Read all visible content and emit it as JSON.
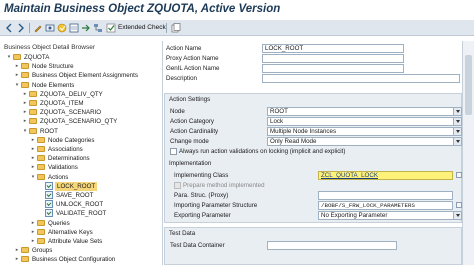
{
  "window": {
    "title": "Maintain Business Object ZQUOTA, Active Version"
  },
  "toolbar": {
    "extended_check_label": "Extended Check"
  },
  "tree": {
    "header": "Business Object Detail Browser",
    "items": [
      {
        "label": "ZQUOTA",
        "indent": 0,
        "toggle": "▾",
        "icon": "folder"
      },
      {
        "label": "Node Structure",
        "indent": 1,
        "toggle": "▸",
        "icon": "folder"
      },
      {
        "label": "Business Object Element Assignments",
        "indent": 1,
        "toggle": "▸",
        "icon": "folder"
      },
      {
        "label": "Node Elements",
        "indent": 1,
        "toggle": "▾",
        "icon": "folder"
      },
      {
        "label": "ZQUOTA_DELIV_QTY",
        "indent": 2,
        "toggle": "▸",
        "icon": "folder"
      },
      {
        "label": "ZQUOTA_ITEM",
        "indent": 2,
        "toggle": "▸",
        "icon": "folder"
      },
      {
        "label": "ZQUOTA_SCENARIO",
        "indent": 2,
        "toggle": "▸",
        "icon": "folder"
      },
      {
        "label": "ZQUOTA_SCENARIO_QTY",
        "indent": 2,
        "toggle": "▸",
        "icon": "folder"
      },
      {
        "label": "ROOT",
        "indent": 2,
        "toggle": "▾",
        "icon": "folder"
      },
      {
        "label": "Node Categories",
        "indent": 3,
        "toggle": "▸",
        "icon": "folder"
      },
      {
        "label": "Associations",
        "indent": 3,
        "toggle": "▸",
        "icon": "folder"
      },
      {
        "label": "Determinations",
        "indent": 3,
        "toggle": "▸",
        "icon": "folder"
      },
      {
        "label": "Validations",
        "indent": 3,
        "toggle": "▸",
        "icon": "folder"
      },
      {
        "label": "Actions",
        "indent": 3,
        "toggle": "▾",
        "icon": "folder"
      },
      {
        "label": "LOCK_ROOT",
        "indent": 4,
        "toggle": "",
        "icon": "leaf",
        "selected": true
      },
      {
        "label": "SAVE_ROOT",
        "indent": 4,
        "toggle": "",
        "icon": "leaf"
      },
      {
        "label": "UNLOCK_ROOT",
        "indent": 4,
        "toggle": "",
        "icon": "leaf"
      },
      {
        "label": "VALIDATE_ROOT",
        "indent": 4,
        "toggle": "",
        "icon": "leaf"
      },
      {
        "label": "Queries",
        "indent": 3,
        "toggle": "▸",
        "icon": "folder"
      },
      {
        "label": "Alternative Keys",
        "indent": 3,
        "toggle": "▸",
        "icon": "folder"
      },
      {
        "label": "Attribute Value Sets",
        "indent": 3,
        "toggle": "▸",
        "icon": "folder"
      },
      {
        "label": "Groups",
        "indent": 1,
        "toggle": "▸",
        "icon": "folder"
      },
      {
        "label": "Business Object Configuration",
        "indent": 1,
        "toggle": "▸",
        "icon": "folder"
      }
    ]
  },
  "detail": {
    "action_name_label": "Action Name",
    "action_name_value": "LOCK_ROOT",
    "proxy_action_name_label": "Proxy Action Name",
    "proxy_action_name_value": "",
    "genil_action_name_label": "GenIL Action Name",
    "genil_action_name_value": "",
    "description_label": "Description",
    "description_value": ""
  },
  "action_settings": {
    "title": "Action Settings",
    "node_label": "Node",
    "node_value": "ROOT",
    "category_label": "Action Category",
    "category_value": "Lock",
    "cardinality_label": "Action Cardinality",
    "cardinality_value": "Multiple Node Instances",
    "change_mode_label": "Change mode",
    "change_mode_value": "Only Read Mode",
    "always_run_label": "Always run action validations on locking (implicit and explicit)"
  },
  "implementation": {
    "title": "Implementation",
    "class_label": "Implementing Class",
    "class_value": "ZCL_QUOTA_LOCK",
    "prepare_label": "Prepare method implemented",
    "param_struc_label": "Para. Struc. (Proxy)",
    "param_struc_value": "",
    "import_param_label": "Importing Parameter Structure",
    "import_param_value": "/BOBF/S_FRW_LOCK_PARAMETERS",
    "export_param_label": "Exporting Parameter",
    "export_param_value": "No Exporting Parameter"
  },
  "test_data": {
    "title": "Test Data",
    "container_label": "Test Data Container"
  }
}
